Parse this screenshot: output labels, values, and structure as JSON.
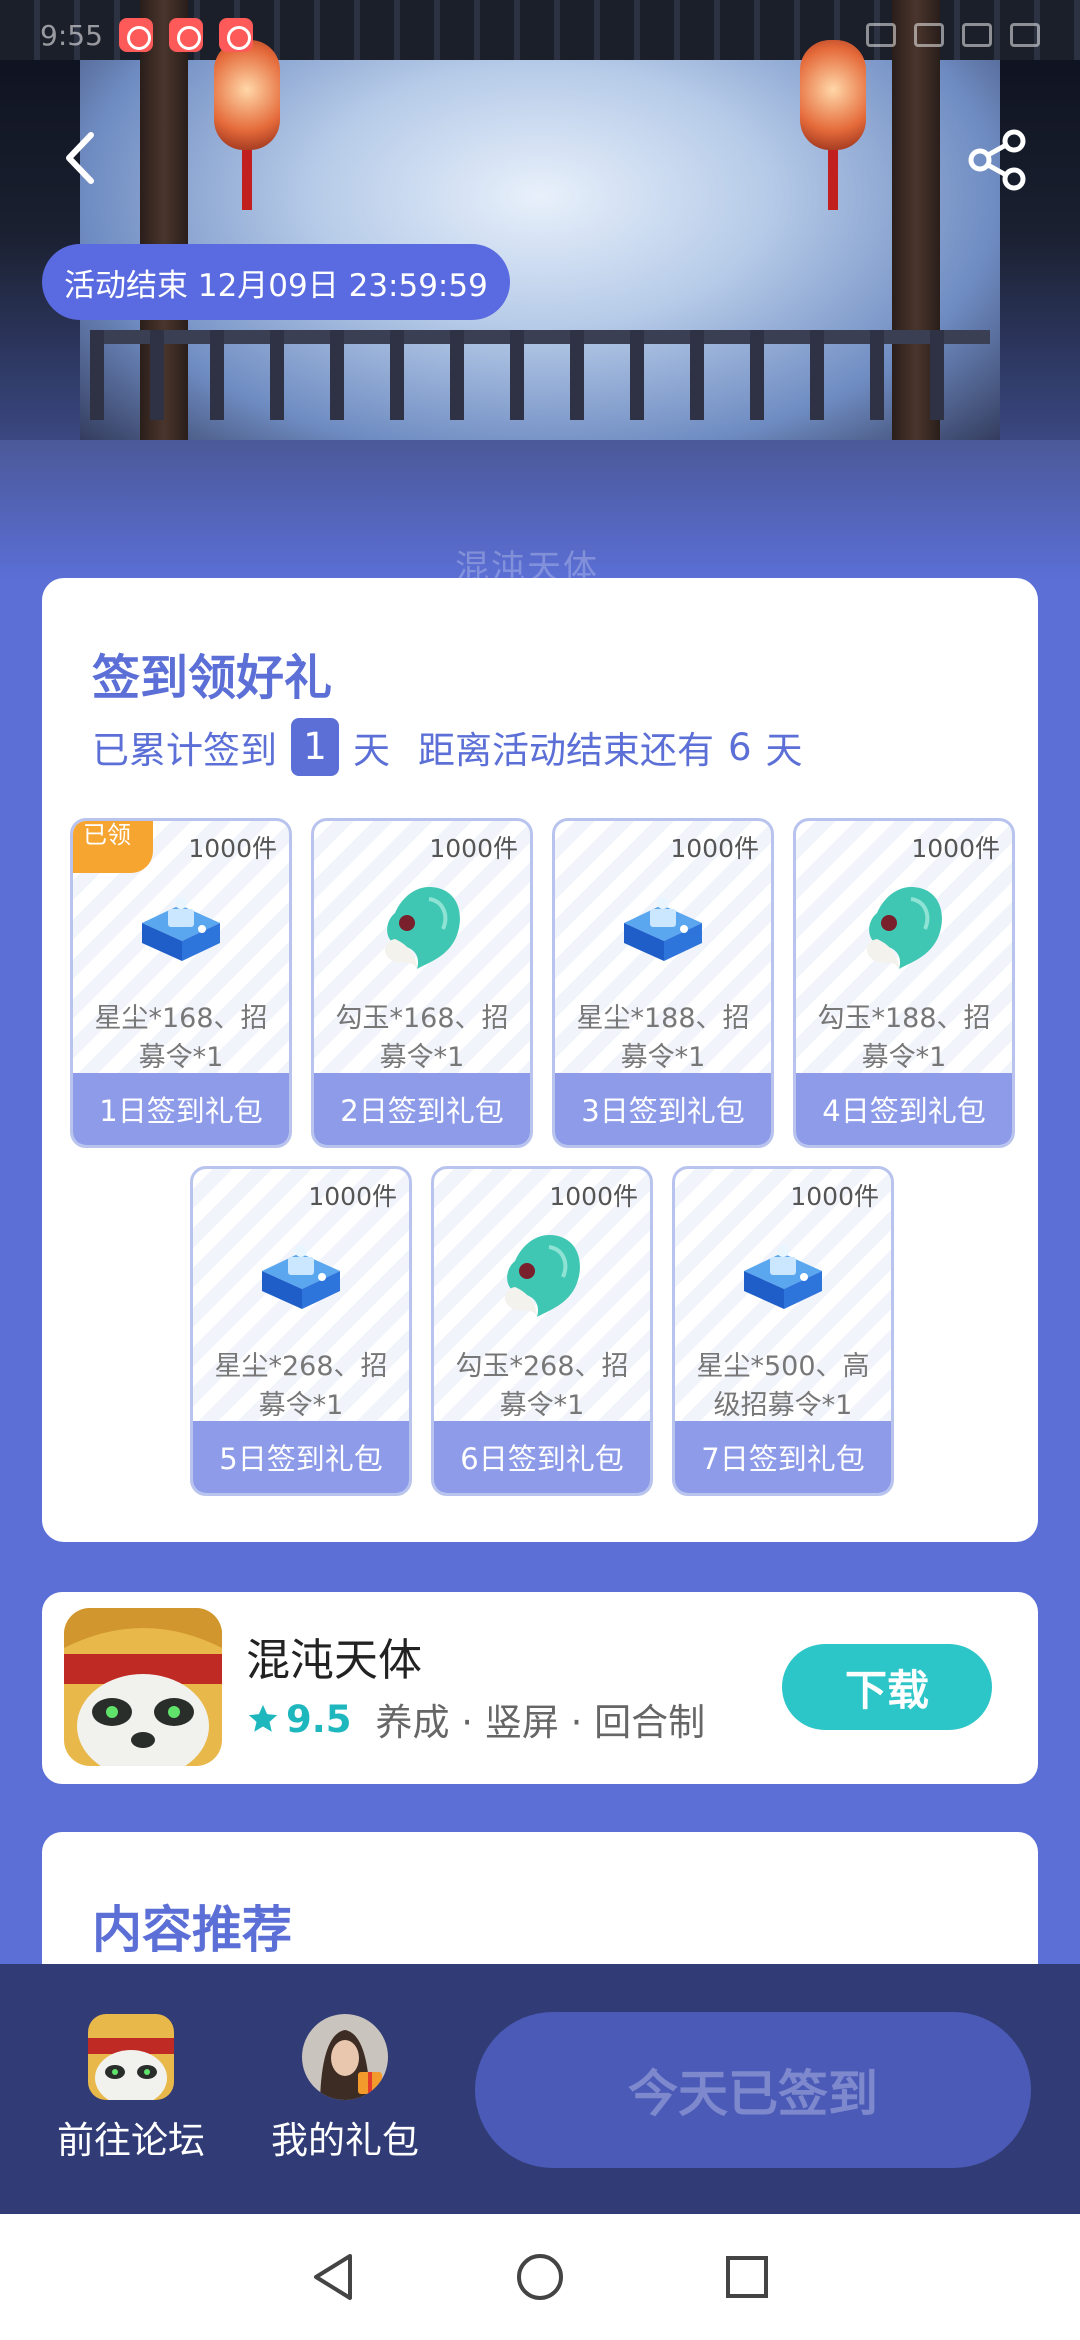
{
  "status_bar": {
    "time": "9:55"
  },
  "header": {
    "activity_end_label": "活动结束 12月09日 23:59:59",
    "watermark": "混沌天体"
  },
  "signin": {
    "title": "签到领好礼",
    "progress_prefix": "已累计签到",
    "days_signed": "1",
    "day_unit": "天",
    "remaining_prefix": "距离活动结束还有",
    "days_remaining": "6",
    "remaining_unit": "天",
    "claimed_tag": "已领",
    "gifts": [
      {
        "stock": "1000件",
        "desc": "星尘*168、招募令*1",
        "name": "1日签到礼包",
        "icon": "stardust-chest-icon",
        "claimed": true
      },
      {
        "stock": "1000件",
        "desc": "勾玉*168、招募令*1",
        "name": "2日签到礼包",
        "icon": "magatama-jade-icon",
        "claimed": false
      },
      {
        "stock": "1000件",
        "desc": "星尘*188、招募令*1",
        "name": "3日签到礼包",
        "icon": "stardust-chest-icon",
        "claimed": false
      },
      {
        "stock": "1000件",
        "desc": "勾玉*188、招募令*1",
        "name": "4日签到礼包",
        "icon": "magatama-jade-icon",
        "claimed": false
      },
      {
        "stock": "1000件",
        "desc": "星尘*268、招募令*1",
        "name": "5日签到礼包",
        "icon": "stardust-chest-icon",
        "claimed": false
      },
      {
        "stock": "1000件",
        "desc": "勾玉*268、招募令*1",
        "name": "6日签到礼包",
        "icon": "magatama-jade-icon",
        "claimed": false
      },
      {
        "stock": "1000件",
        "desc": "星尘*500、高级招募令*1",
        "name": "7日签到礼包",
        "icon": "stardust-chest-icon",
        "claimed": false
      }
    ]
  },
  "game": {
    "name": "混沌天体",
    "rating": "9.5",
    "tags": "养成 · 竖屏 · 回合制",
    "download_label": "下载"
  },
  "recommend": {
    "title": "内容推荐"
  },
  "action_bar": {
    "forum_label": "前往论坛",
    "gifts_label": "我的礼包",
    "signed_label": "今天已签到"
  },
  "colors": {
    "accent": "#5b6fd6",
    "download": "#2cc5c8",
    "gift_label": "#8d9be8",
    "claimed_tag": "#f7a531",
    "action_bar": "#313c76"
  }
}
